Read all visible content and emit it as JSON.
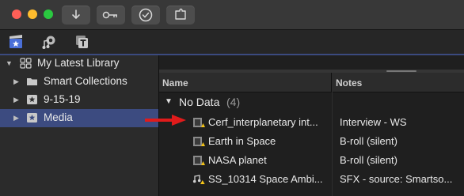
{
  "titlebar": {
    "buttons": [
      {
        "name": "import-download-button",
        "icon": "download-arrow-icon"
      },
      {
        "name": "keyword-button",
        "icon": "key-icon"
      },
      {
        "name": "background-tasks-button",
        "icon": "checkmark-circle-icon"
      },
      {
        "name": "share-button",
        "icon": "puzzle-share-icon"
      }
    ]
  },
  "library_toolbar": {
    "tabs": [
      {
        "name": "libraries-tab",
        "icon": "clapper-star-icon",
        "active": true
      },
      {
        "name": "photos-audio-tab",
        "icon": "music-camera-icon",
        "active": false
      },
      {
        "name": "titles-generators-tab",
        "icon": "titles-t-icon",
        "active": false
      }
    ]
  },
  "sidebar": {
    "library": {
      "label": "My Latest Library",
      "icon": "library-grid-icon"
    },
    "items": [
      {
        "label": "Smart Collections",
        "icon": "folder-icon",
        "selected": false
      },
      {
        "label": "9-15-19",
        "icon": "event-star-icon",
        "selected": false
      },
      {
        "label": "Media",
        "icon": "event-star-icon",
        "selected": true
      }
    ]
  },
  "browser": {
    "columns": {
      "name": "Name",
      "notes": "Notes"
    },
    "group": {
      "label": "No Data",
      "count": "(4)"
    },
    "rows": [
      {
        "name": "Cerf_interplanetary int...",
        "notes": "Interview - WS",
        "icon": "video-clip-warning-icon"
      },
      {
        "name": "Earth in Space",
        "notes": "B-roll (silent)",
        "icon": "video-clip-warning-icon"
      },
      {
        "name": "NASA planet",
        "notes": "B-roll  (silent)",
        "icon": "video-clip-warning-icon"
      },
      {
        "name": "SS_10314 Space Ambi...",
        "notes": "SFX - source: Smartso...",
        "icon": "audio-clip-warning-icon"
      }
    ]
  },
  "colors": {
    "accent": "#3c4b80",
    "arrow": "#e01b1b",
    "warning": "#f5c518"
  }
}
